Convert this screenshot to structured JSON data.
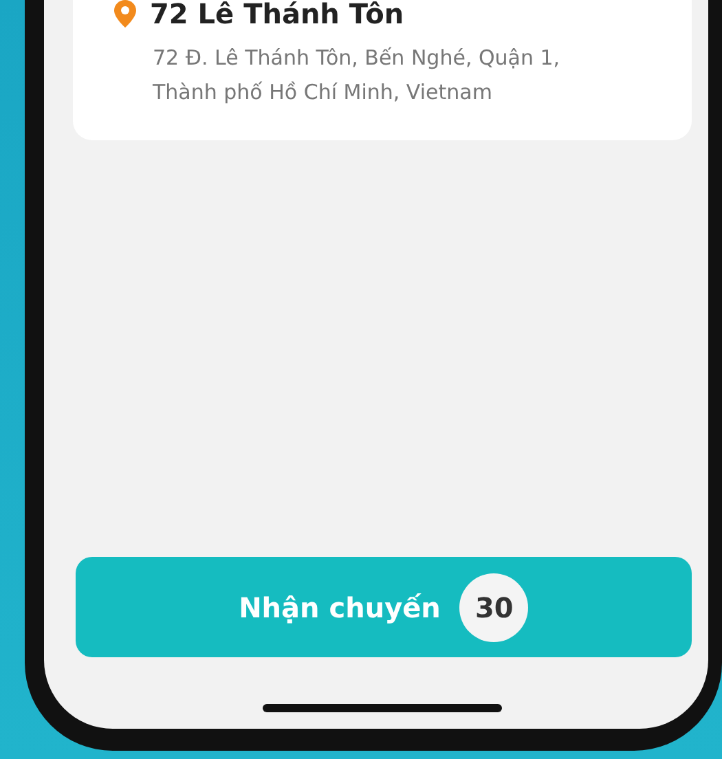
{
  "address_card": {
    "title": "72 Lê Thánh Tôn",
    "address": "72 Đ. Lê Thánh Tôn, Bến Nghé, Quận 1, Thành phố Hồ Chí Minh, Vietnam"
  },
  "accept_button": {
    "label": "Nhận chuyến",
    "count": "30"
  }
}
